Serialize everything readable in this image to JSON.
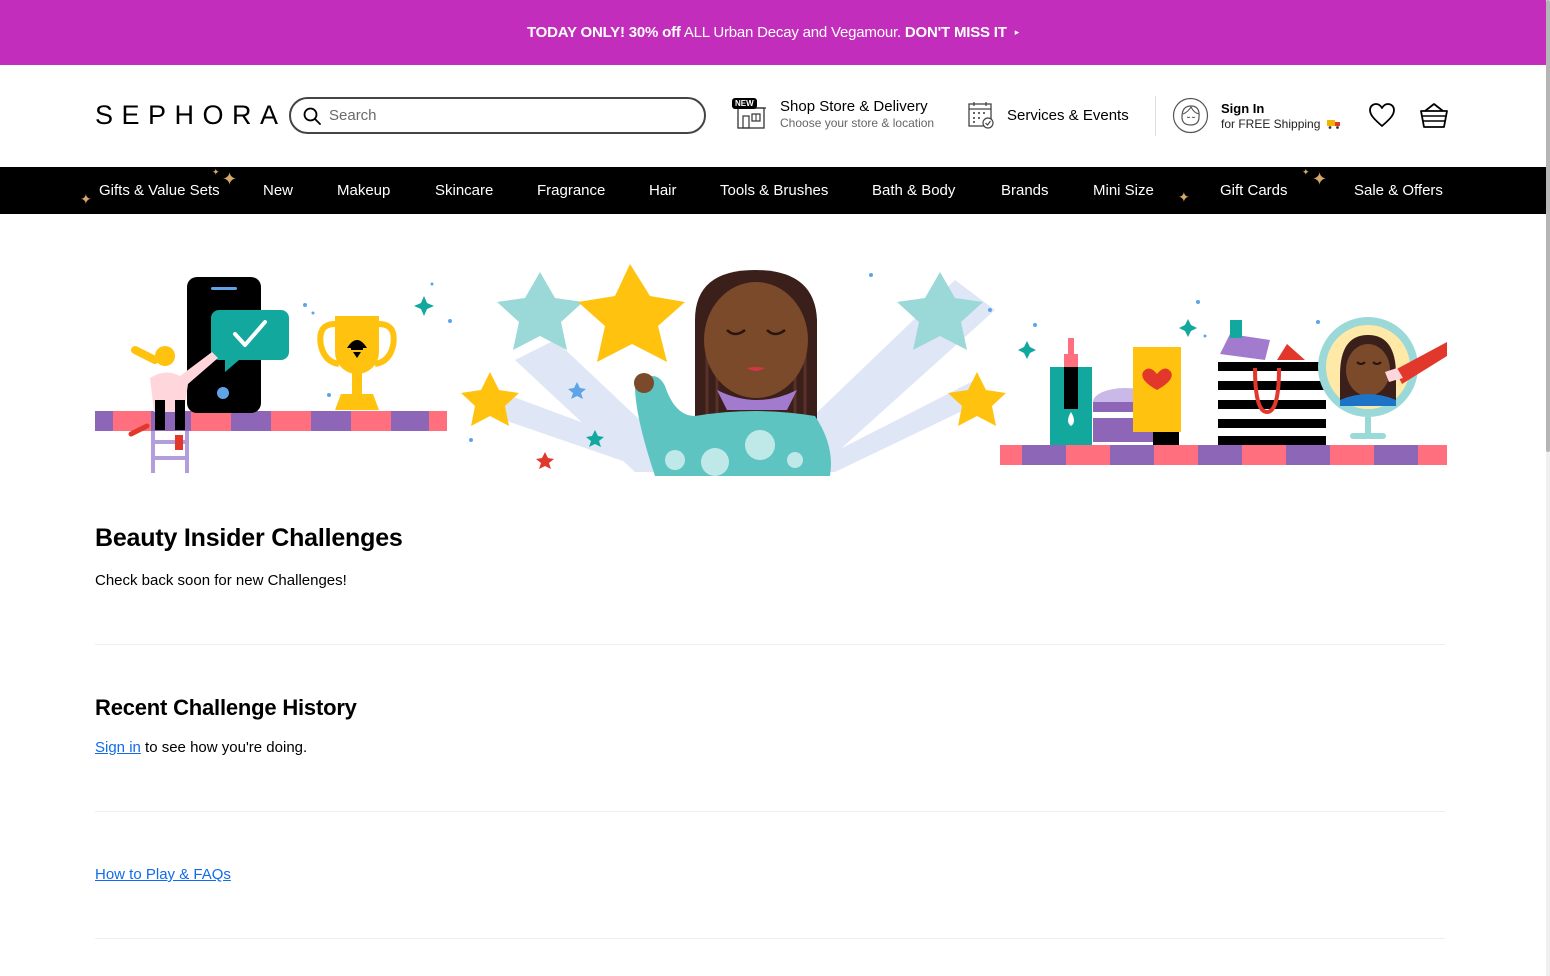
{
  "promo": {
    "bold1": "TODAY ONLY! 30% off",
    "text": " ALL Urban Decay and Vegamour. ",
    "bold2": "DON'T MISS IT",
    "arrow": "▸"
  },
  "header": {
    "logo": "SEPHORA",
    "search_placeholder": "Search",
    "shop": {
      "badge": "NEW",
      "title": "Shop Store & Delivery",
      "subtitle": "Choose your store & location"
    },
    "services": {
      "title": "Services & Events"
    },
    "signin": {
      "title": "Sign In",
      "subtitle": "for FREE Shipping"
    }
  },
  "nav": {
    "items": [
      "Gifts & Value Sets",
      "New",
      "Makeup",
      "Skincare",
      "Fragrance",
      "Hair",
      "Tools & Brushes",
      "Bath & Body",
      "Brands",
      "Mini Size",
      "Gift Cards",
      "Sale & Offers"
    ]
  },
  "challenges": {
    "title": "Beauty Insider Challenges",
    "text": "Check back soon for new Challenges!"
  },
  "history": {
    "title": "Recent Challenge History",
    "link": "Sign in",
    "text": " to see how you're doing."
  },
  "faq": {
    "link": "How to Play & FAQs"
  },
  "colors": {
    "promo": "#c22ebb",
    "nav": "#000000",
    "link": "#136bea",
    "teal": "#9ad9d8",
    "yellow": "#ffc20e",
    "purple": "#8d66b8",
    "pink": "#ff6f7d"
  }
}
